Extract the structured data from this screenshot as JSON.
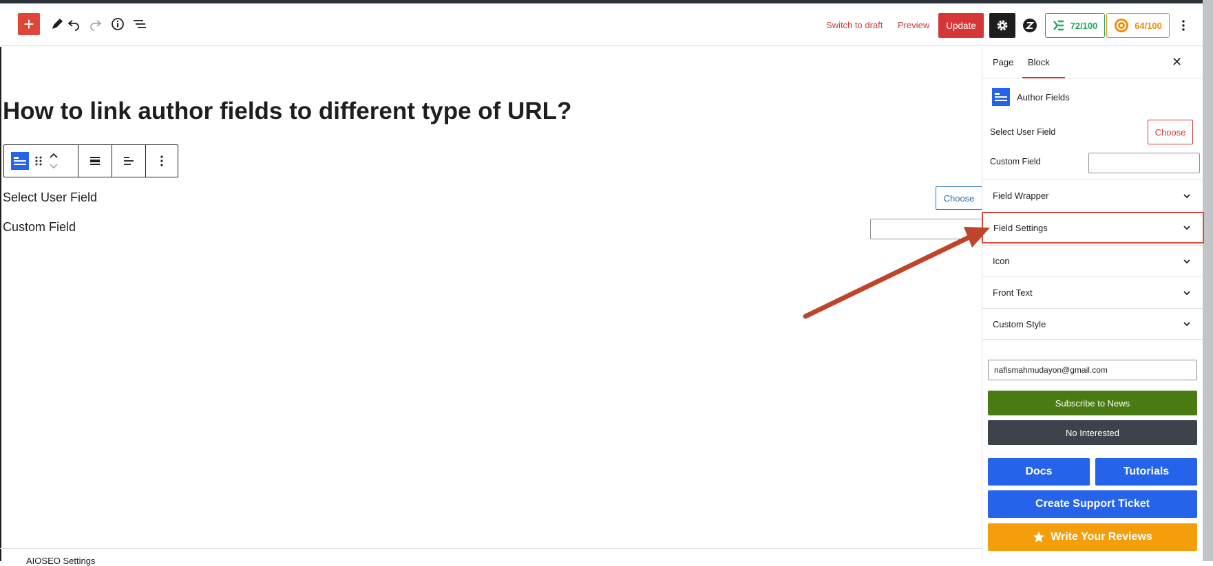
{
  "toolbar": {
    "add_icon": "plus-icon",
    "tools_icon": "pencil-icon",
    "undo_icon": "undo-icon",
    "redo_icon": "redo-icon",
    "details_icon": "info-icon",
    "list_view_icon": "list-view-icon",
    "switch_to_draft": "Switch to draft",
    "preview": "Preview",
    "update": "Update",
    "settings_icon": "gear-icon",
    "plugin_icon": "z-logo-icon",
    "score_seo": "72/100",
    "score_readability": "64/100",
    "more_icon": "kebab-menu-icon"
  },
  "editor": {
    "title": "How to link author fields to different type of URL?",
    "block_toolbar": {
      "block_icon": "author-fields-block-icon",
      "drag_icon": "drag-handle-icon",
      "move_icon": "move-up-down-icon",
      "align_icon": "align-wide-icon",
      "text_align_icon": "text-align-left-icon",
      "options_icon": "vertical-dots-icon"
    },
    "select_user_field_label": "Select User Field",
    "choose_label": "Choose",
    "custom_field_label": "Custom Field",
    "custom_field_value": "",
    "footer_text": "AIOSEO Settings"
  },
  "sidebar": {
    "tabs": [
      {
        "label": "Page"
      },
      {
        "label": "Block"
      }
    ],
    "active_tab": "Block",
    "close_icon": "close-icon",
    "block_card": {
      "icon": "author-fields-block-icon",
      "name": "Author Fields"
    },
    "select_user_field_label": "Select User Field",
    "choose_label": "Choose",
    "custom_field_label": "Custom Field",
    "custom_field_value": "",
    "panels": [
      {
        "label": "Field Wrapper"
      },
      {
        "label": "Field Settings"
      },
      {
        "label": "Icon"
      },
      {
        "label": "Front Text"
      },
      {
        "label": "Custom Style"
      }
    ],
    "highlighted_panel": "Field Settings",
    "email_value": "nafismahmudayon@gmail.com",
    "subscribe_label": "Subscribe to News",
    "no_interest_label": "No Interested",
    "docs_label": "Docs",
    "tutorials_label": "Tutorials",
    "support_label": "Create Support Ticket",
    "reviews_label": "Write Your Reviews"
  },
  "colors": {
    "accent_red": "#d63638",
    "add_button": "#e0453a",
    "seo_green": "#1fa75c",
    "readability_orange": "#f28c00",
    "block_blue": "#2563eb",
    "subscribe_green": "#4a7a12",
    "dark_gray": "#3c434a",
    "reviews_orange": "#f59e0b",
    "annotation_arrow": "#c0432b"
  }
}
